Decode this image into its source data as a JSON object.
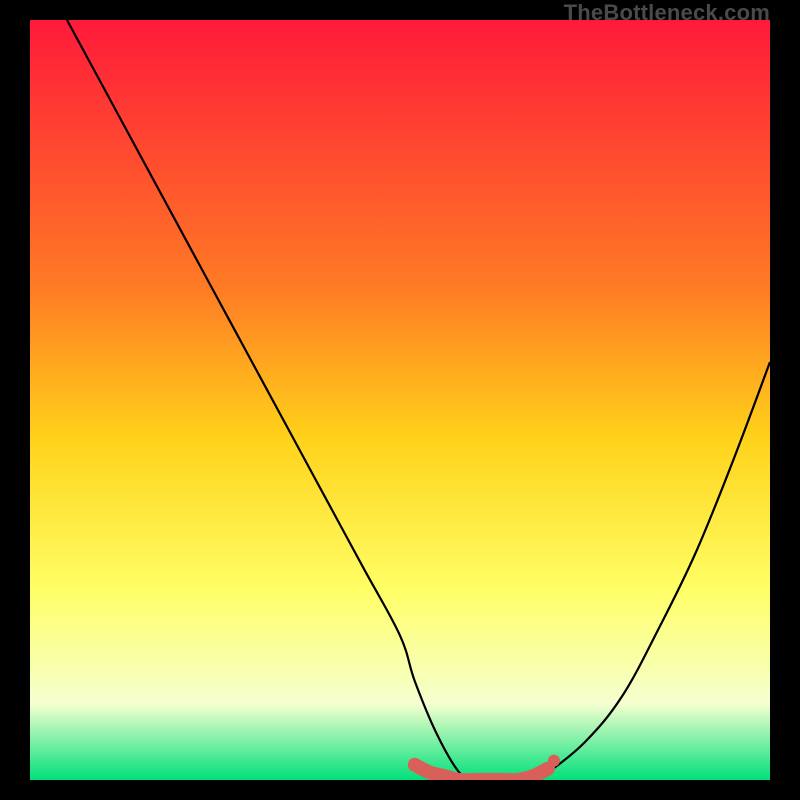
{
  "watermark": "TheBottleneck.com",
  "colors": {
    "gradient_top": "#ff1a3a",
    "gradient_mid1": "#ff7a25",
    "gradient_mid2": "#ffd21a",
    "gradient_mid3": "#ffff66",
    "gradient_mid4": "#f5ffd0",
    "gradient_bottom": "#00e07a",
    "curve": "#000000",
    "marker": "#d9605a"
  },
  "chart_data": {
    "type": "line",
    "title": "",
    "xlabel": "",
    "ylabel": "",
    "xlim": [
      0,
      100
    ],
    "ylim": [
      0,
      100
    ],
    "series": [
      {
        "name": "bottleneck-curve",
        "x": [
          5,
          10,
          15,
          20,
          25,
          30,
          35,
          40,
          45,
          50,
          52,
          55,
          58,
          60,
          62,
          64,
          66,
          68,
          70,
          75,
          80,
          85,
          90,
          95,
          100
        ],
        "y": [
          100,
          91,
          82,
          73,
          64,
          55,
          46,
          37,
          28,
          19,
          13,
          6,
          1,
          0,
          0,
          0,
          0,
          0,
          1,
          5,
          11,
          20,
          30,
          42,
          55
        ]
      }
    ],
    "markers": {
      "name": "highlight-band",
      "x": [
        52,
        54,
        56,
        58,
        60,
        62,
        64,
        66,
        68,
        70
      ],
      "y": [
        2,
        1,
        0.5,
        0,
        0,
        0,
        0,
        0,
        0.5,
        1.5
      ]
    }
  }
}
